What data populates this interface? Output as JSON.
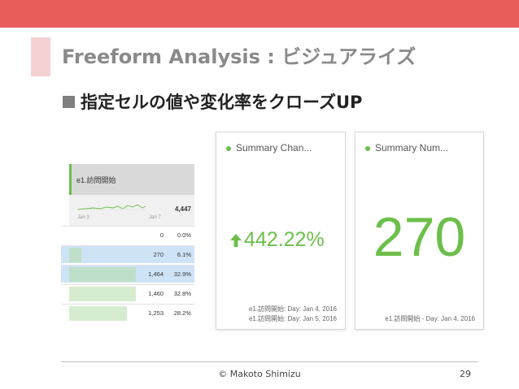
{
  "slide": {
    "title": "Freeform Analysis : ビジュアライズ",
    "bullet": "指定セルの値や変化率をクローズUP",
    "copyright": "© Makoto Shimizu",
    "page_number": "29",
    "accent_color": "#e85c5a",
    "green_color": "#6cbf4a"
  },
  "table": {
    "header": "e1.訪問開始",
    "summary_total": "4,447",
    "sparkline_start": "Jan 3",
    "sparkline_end": "Jan 7",
    "rows": [
      {
        "value": "0",
        "percent": "0.0%",
        "bar_fraction": 0.0,
        "selected": false
      },
      {
        "value": "270",
        "percent": "6.1%",
        "bar_fraction": 0.061,
        "selected": true
      },
      {
        "value": "1,464",
        "percent": "32.9%",
        "bar_fraction": 0.329,
        "selected": true
      },
      {
        "value": "1,460",
        "percent": "32.8%",
        "bar_fraction": 0.328,
        "selected": false
      },
      {
        "value": "1,253",
        "percent": "28.2%",
        "bar_fraction": 0.282,
        "selected": false
      }
    ]
  },
  "card_change": {
    "title": "Summary Chan...",
    "value": "442.22%",
    "icon": "up-arrow-icon",
    "footer_line1": "e1.訪問開始: Day: Jan 4, 2016",
    "footer_line2": "e1.訪問開始: Day: Jan 5, 2016"
  },
  "card_number": {
    "title": "Summary Num...",
    "value": "270",
    "footer": "e1.訪問開始 - Day: Jan 4, 2016"
  }
}
